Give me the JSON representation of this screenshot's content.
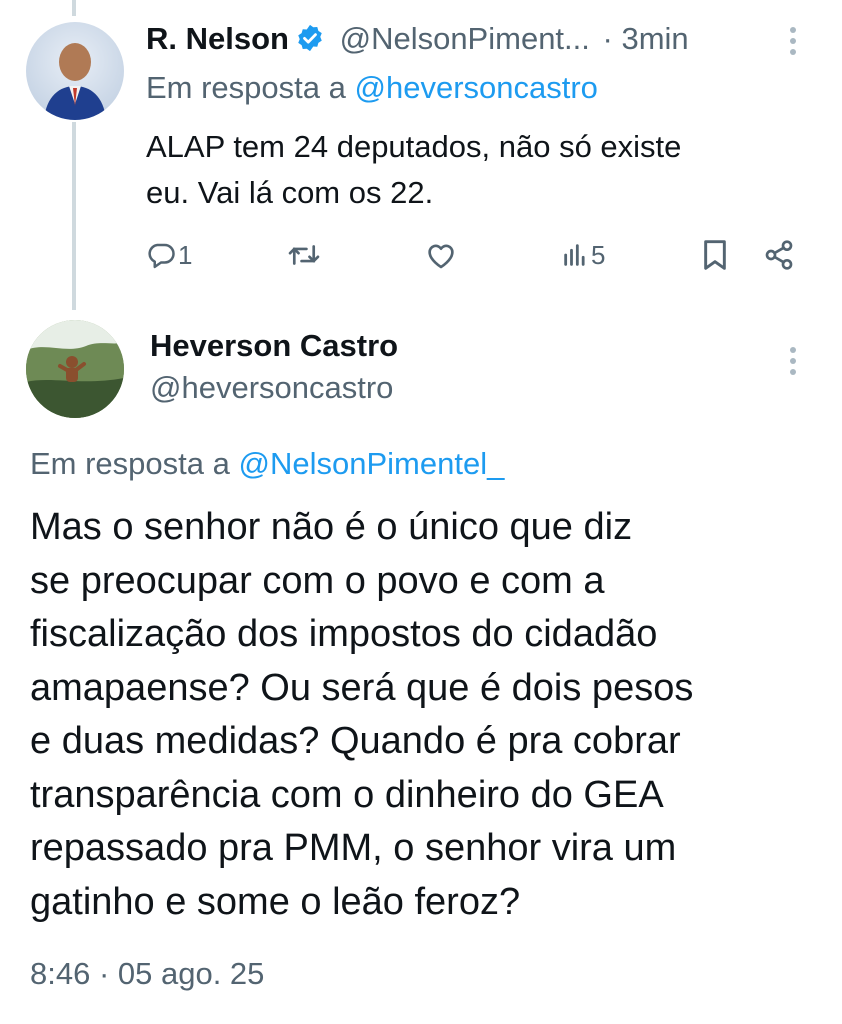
{
  "reply_tweet": {
    "display_name": "R. Nelson",
    "handle": "@NelsonPiment...",
    "time": "· 3min",
    "reply_prefix": "Em resposta a",
    "reply_to": "@heversoncastro",
    "text_line1": "ALAP tem 24 deputados, não só existe",
    "text_line2": "eu. Vai lá com os 22.",
    "reply_count": "1",
    "views_count": "5",
    "icons": [
      "verified-badge",
      "reply-icon",
      "retweet-icon",
      "like-icon",
      "views-icon",
      "bookmark-icon",
      "share-icon",
      "more-icon"
    ]
  },
  "main_tweet": {
    "display_name": "Heverson Castro",
    "handle": "@heversoncastro",
    "reply_prefix": "Em resposta a",
    "reply_to": "@NelsonPimentel_",
    "text_lines": [
      "Mas o senhor não é o único que diz",
      "se preocupar com o povo e com a",
      "fiscalização dos impostos do cidadão",
      "amapaense? Ou será que é dois pesos",
      "e duas medidas? Quando é pra cobrar",
      "transparência com o dinheiro do GEA",
      "repassado pra PMM, o senhor vira um",
      "gatinho e some o leão feroz?"
    ],
    "timestamp": "8:46 · 05 ago. 25"
  },
  "colors": {
    "text": "#0f1419",
    "secondary": "#536471",
    "link": "#1d9bf0",
    "thread_line": "#cfd9de"
  }
}
